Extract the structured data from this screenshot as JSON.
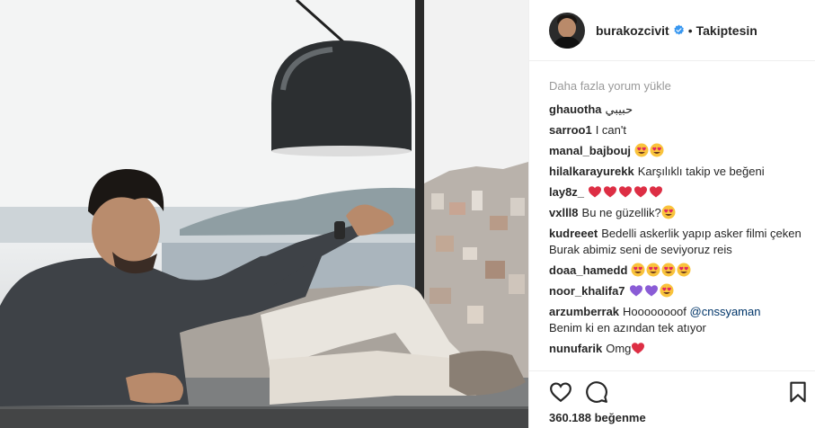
{
  "post": {
    "username": "burakozcivit",
    "separator": "•",
    "follow_status": "Takiptesin",
    "load_more": "Daha fazla yorum yükle",
    "likes": "360.188 beğenme"
  },
  "comments": [
    {
      "user": "ghauotha",
      "text": "حبيبي",
      "emoji": []
    },
    {
      "user": "sarroo1",
      "text": "I can't",
      "emoji": []
    },
    {
      "user": "manal_bajbouj",
      "text": "",
      "emoji": [
        "heart-eyes",
        "heart-eyes"
      ]
    },
    {
      "user": "hilalkarayurekk",
      "text": "Karşılıklı takip ve beğeni",
      "emoji": []
    },
    {
      "user": "lay8z_",
      "text": "",
      "emoji": [
        "red-heart",
        "red-heart",
        "red-heart",
        "red-heart",
        "red-heart"
      ]
    },
    {
      "user": "vxlll8",
      "text": "Bu ne güzellik?",
      "emoji": [
        "heart-eyes"
      ]
    },
    {
      "user": "kudreeet",
      "text": "Bedelli askerlik yapıp asker filmi çeken Burak abimiz seni de seviyoruz reis",
      "emoji": []
    },
    {
      "user": "doaa_hamedd",
      "text": "",
      "emoji": [
        "heart-eyes",
        "heart-eyes",
        "heart-eyes",
        "heart-eyes"
      ]
    },
    {
      "user": "noor_khalifa7",
      "text": "",
      "emoji": [
        "purple-heart",
        "purple-heart",
        "heart-eyes"
      ]
    },
    {
      "user": "arzumberrak",
      "text": "Hoooooooof",
      "mention": "@cnssyaman",
      "text2": "Benim ki en azından tek atıyor",
      "emoji": []
    },
    {
      "user": "nunufarik",
      "text": "Omg",
      "emoji": [
        "red-heart"
      ]
    }
  ],
  "icons": {
    "verified": "verified-badge-icon",
    "like": "heart-outline-icon",
    "comment": "speech-bubble-icon",
    "save": "bookmark-icon"
  },
  "colors": {
    "text": "#262626",
    "muted": "#999999",
    "mention": "#003569",
    "verified": "#3897f0",
    "heart": "#e0245e",
    "purple": "#8a5cd6"
  }
}
